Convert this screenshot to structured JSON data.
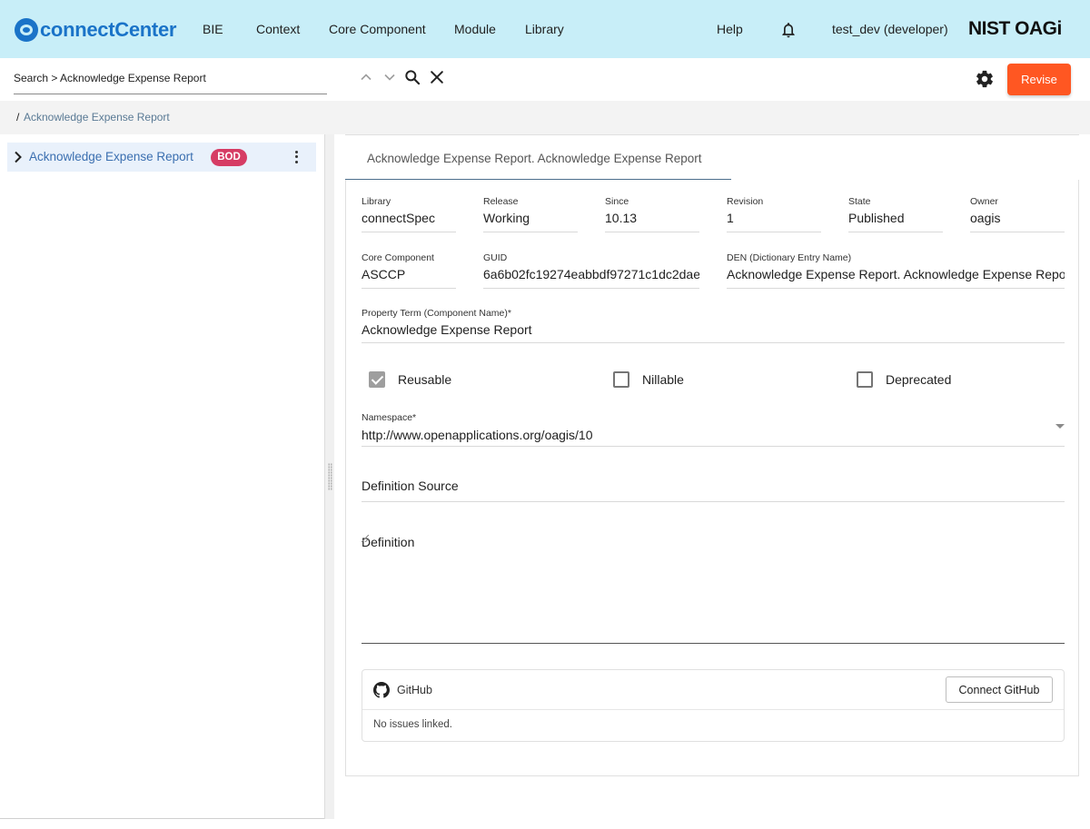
{
  "header": {
    "logo_text_1": "connect",
    "logo_text_2": "Center",
    "nav": [
      "BIE",
      "Context",
      "Core Component",
      "Module",
      "Library"
    ],
    "help": "Help",
    "user": "test_dev (developer)",
    "brand": "NIST OAGi"
  },
  "search": {
    "value": "Search > Acknowledge Expense Report"
  },
  "toolbar": {
    "revise_label": "Revise"
  },
  "breadcrumb": {
    "separator": "/",
    "current": "Acknowledge Expense Report"
  },
  "tree": {
    "root_label": "Acknowledge Expense Report",
    "root_badge": "BOD"
  },
  "tab": {
    "label": "Acknowledge Expense Report. Acknowledge Expense Report"
  },
  "detail": {
    "library": {
      "label": "Library",
      "value": "connectSpec"
    },
    "release": {
      "label": "Release",
      "value": "Working"
    },
    "since": {
      "label": "Since",
      "value": "10.13"
    },
    "revision": {
      "label": "Revision",
      "value": "1"
    },
    "state": {
      "label": "State",
      "value": "Published"
    },
    "owner": {
      "label": "Owner",
      "value": "oagis"
    },
    "core_component": {
      "label": "Core Component",
      "value": "ASCCP"
    },
    "guid": {
      "label": "GUID",
      "value": "6a6b02fc19274eabbdf97271c1dc2dae"
    },
    "den": {
      "label": "DEN (Dictionary Entry Name)",
      "value": "Acknowledge Expense Report. Acknowledge Expense Report"
    },
    "property_term": {
      "label": "Property Term (Component Name)*",
      "value": "Acknowledge Expense Report"
    },
    "reusable": {
      "label": "Reusable",
      "checked": true
    },
    "nillable": {
      "label": "Nillable",
      "checked": false
    },
    "deprecated": {
      "label": "Deprecated",
      "checked": false
    },
    "namespace": {
      "label": "Namespace*",
      "value": "http://www.openapplications.org/oagis/10"
    },
    "definition_source": {
      "placeholder": "Definition Source"
    },
    "definition": {
      "placeholder": "Definition"
    }
  },
  "github": {
    "title": "GitHub",
    "connect_label": "Connect GitHub",
    "empty_text": "No issues linked."
  },
  "colors": {
    "nav_bg": "#c8eef8",
    "accent": "#ff5722",
    "badge": "#d63c64",
    "link": "#3b6fb0"
  }
}
